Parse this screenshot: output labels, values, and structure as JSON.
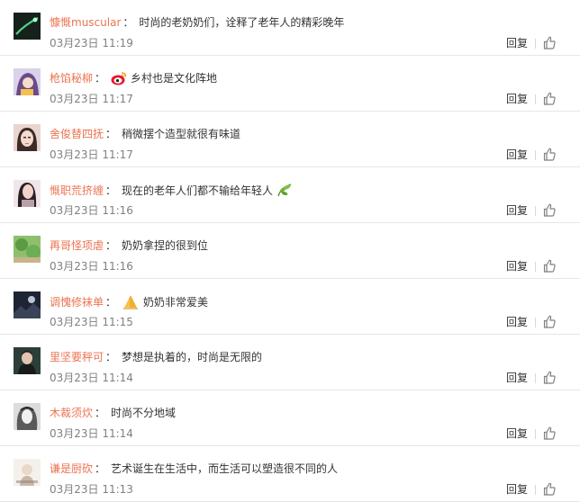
{
  "comments": [
    {
      "user": "慷慨muscular",
      "text": "时尚的老奶奶们，诠释了老年人的精彩晚年",
      "time": "03月23日 11:19",
      "reply": "回复",
      "avatar": "dark-green-streak",
      "prefix_emoji": "",
      "suffix_emoji": ""
    },
    {
      "user": "枪馅秘柳",
      "text": "乡村也是文化阵地",
      "time": "03月23日 11:17",
      "reply": "回复",
      "avatar": "purple-hood",
      "prefix_emoji": "weibo-icon",
      "suffix_emoji": ""
    },
    {
      "user": "舍俊替四抚",
      "text": "稍微摆个造型就很有味道",
      "time": "03月23日 11:17",
      "reply": "回复",
      "avatar": "woman-face",
      "prefix_emoji": "",
      "suffix_emoji": ""
    },
    {
      "user": "慨职荒挤缠",
      "text": "现在的老年人们都不输给年轻人",
      "time": "03月23日 11:16",
      "reply": "回复",
      "avatar": "dark-hair-woman",
      "prefix_emoji": "",
      "suffix_emoji": "leaf-icon"
    },
    {
      "user": "再哥怪项虐",
      "text": "奶奶拿捏的很到位",
      "time": "03月23日 11:16",
      "reply": "回复",
      "avatar": "green-nature",
      "prefix_emoji": "",
      "suffix_emoji": ""
    },
    {
      "user": "调愧修袜单",
      "text": "奶奶非常爱美",
      "time": "03月23日 11:15",
      "reply": "回复",
      "avatar": "dark-night",
      "prefix_emoji": "praying-hands-icon",
      "suffix_emoji": ""
    },
    {
      "user": "里坚要秤可",
      "text": "梦想是执着的，时尚是无限的",
      "time": "03月23日 11:14",
      "reply": "回复",
      "avatar": "man-portrait",
      "prefix_emoji": "",
      "suffix_emoji": ""
    },
    {
      "user": "木裁须炊",
      "text": "时尚不分地域",
      "time": "03月23日 11:14",
      "reply": "回复",
      "avatar": "gray-hair",
      "prefix_emoji": "",
      "suffix_emoji": ""
    },
    {
      "user": "谦是厨砍",
      "text": "艺术诞生在生活中，而生活可以塑造很不同的人",
      "time": "03月23日 11:13",
      "reply": "回复",
      "avatar": "light-sketch",
      "prefix_emoji": "",
      "suffix_emoji": ""
    }
  ]
}
